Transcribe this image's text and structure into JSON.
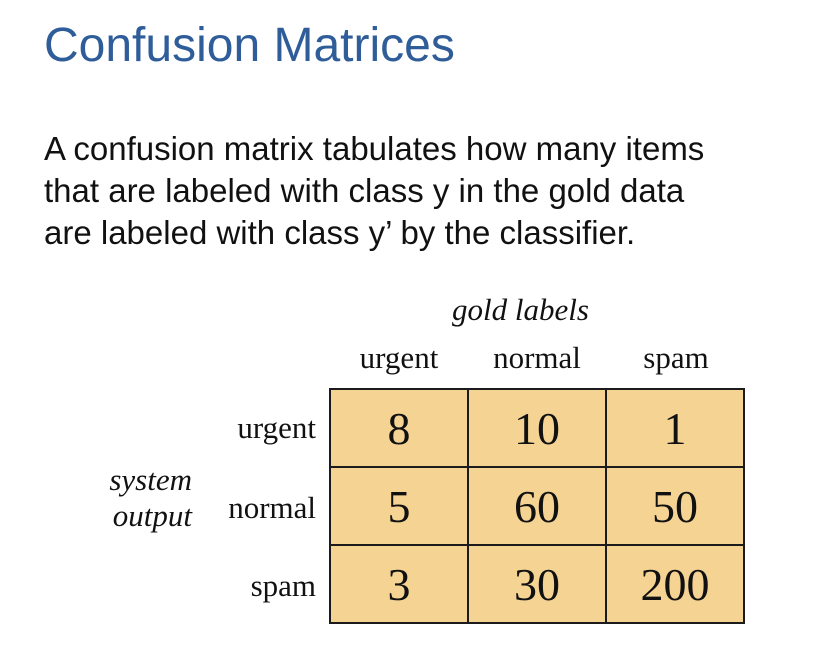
{
  "slide": {
    "title": "Confusion Matrices",
    "body_lines": [
      "A confusion matrix tabulates how many items",
      "that are labeled with class y in the gold data",
      "are labeled with class y’ by the classifier."
    ]
  },
  "matrix": {
    "column_axis_label": "gold labels",
    "row_axis_label_lines": [
      "system",
      "output"
    ],
    "columns": [
      "urgent",
      "normal",
      "spam"
    ],
    "rows": [
      "urgent",
      "normal",
      "spam"
    ],
    "cells": [
      [
        "8",
        "10",
        "1"
      ],
      [
        "5",
        "60",
        "50"
      ],
      [
        "3",
        "30",
        "200"
      ]
    ],
    "cell_color": "#f5d393",
    "title_color": "#2f5d9a"
  }
}
